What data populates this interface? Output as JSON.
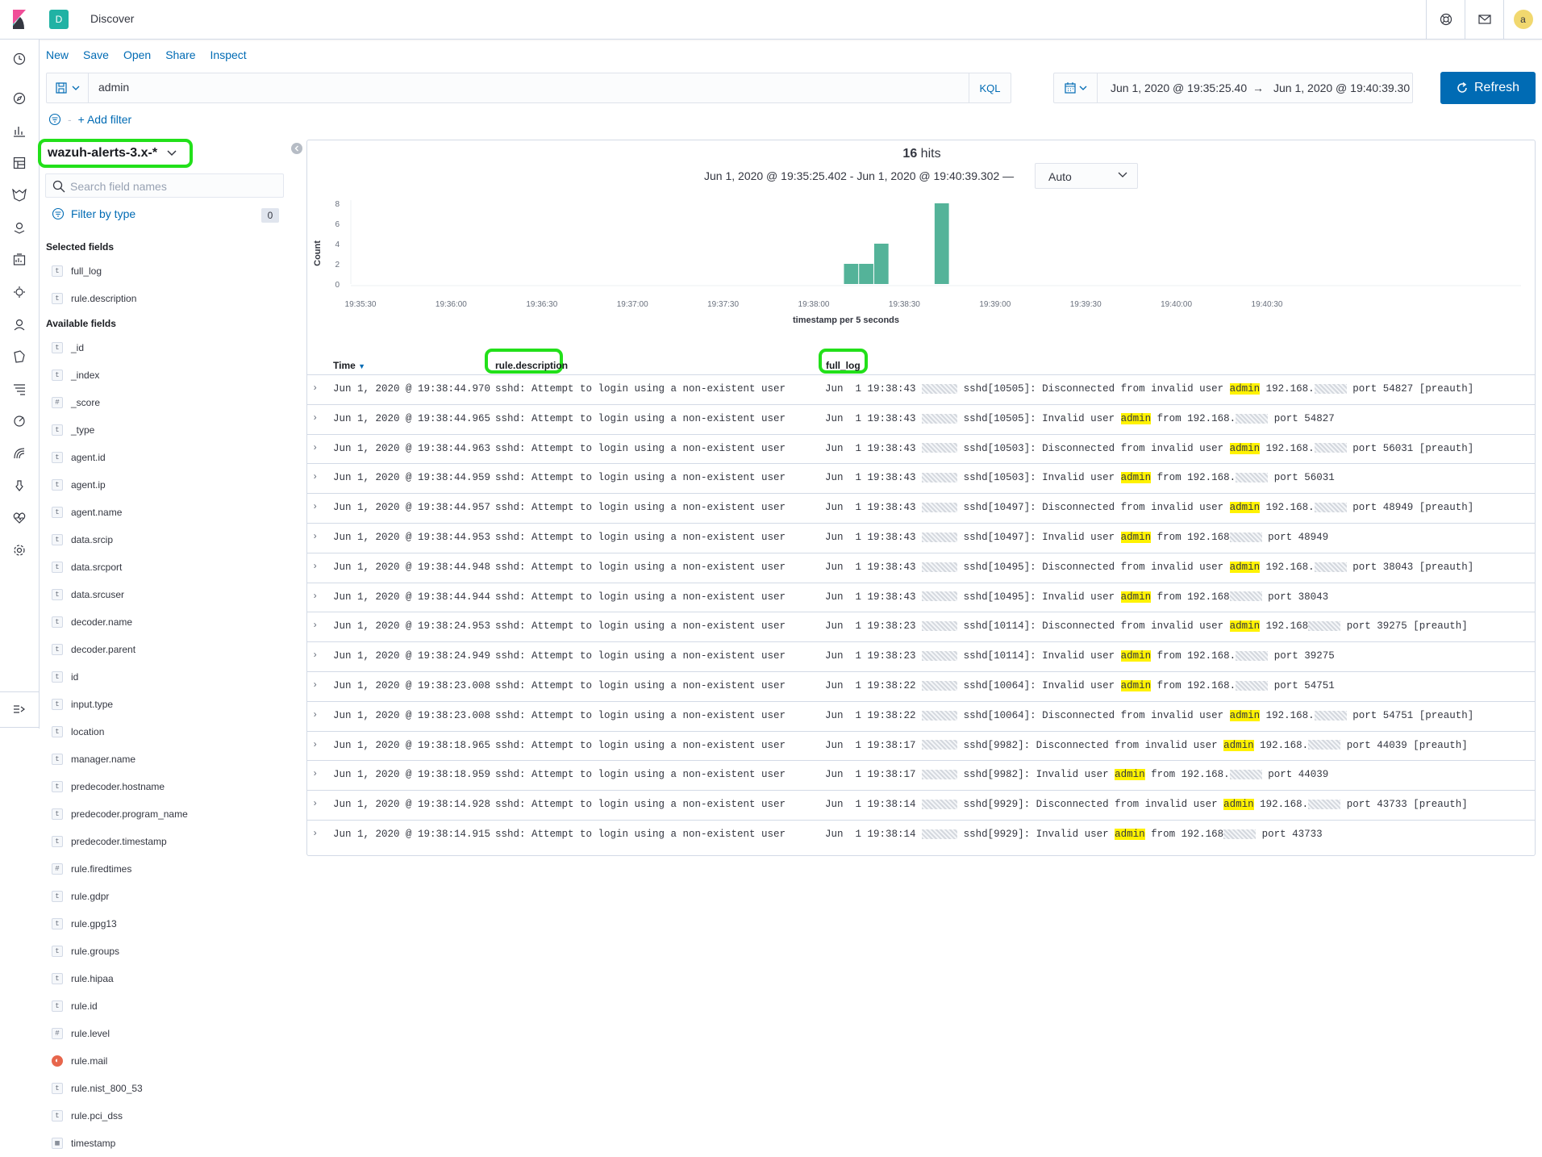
{
  "header": {
    "space_initial": "D",
    "app_title": "Discover",
    "avatar_initial": "a",
    "icons": [
      "help-icon",
      "newsfeed-icon"
    ]
  },
  "nav_icons": [
    "recent-icon",
    "discover-icon",
    "visualize-icon",
    "dashboard-icon",
    "wazuh-icon",
    "maps-icon",
    "canvas-icon",
    "ml-icon",
    "graph-icon",
    "observability-icon",
    "siem-icon",
    "apm-icon",
    "uptime-icon",
    "dev-tools-icon",
    "monitoring-icon",
    "management-icon",
    "dock-navigation-icon"
  ],
  "topnav": [
    "New",
    "Save",
    "Open",
    "Share",
    "Inspect"
  ],
  "query": {
    "value": "admin",
    "language": "KQL"
  },
  "time": {
    "start": "Jun 1, 2020 @ 19:35:25.40",
    "arrow": "→",
    "end": "Jun 1, 2020 @ 19:40:39.30"
  },
  "refresh_label": "Refresh",
  "add_filter_label": "+ Add filter",
  "sidebar": {
    "index_pattern": "wazuh-alerts-3.x-*",
    "search_placeholder": "Search field names",
    "filter_by_type": "Filter by type",
    "filter_count": "0",
    "selected_title": "Selected fields",
    "available_title": "Available fields",
    "selected_fields": [
      {
        "type": "t",
        "name": "full_log"
      },
      {
        "type": "t",
        "name": "rule.description"
      }
    ],
    "available_fields": [
      {
        "type": "t",
        "name": "_id"
      },
      {
        "type": "t",
        "name": "_index"
      },
      {
        "type": "#",
        "name": "_score"
      },
      {
        "type": "t",
        "name": "_type"
      },
      {
        "type": "t",
        "name": "agent.id"
      },
      {
        "type": "t",
        "name": "agent.ip"
      },
      {
        "type": "t",
        "name": "agent.name"
      },
      {
        "type": "t",
        "name": "data.srcip"
      },
      {
        "type": "t",
        "name": "data.srcport"
      },
      {
        "type": "t",
        "name": "data.srcuser"
      },
      {
        "type": "t",
        "name": "decoder.name"
      },
      {
        "type": "t",
        "name": "decoder.parent"
      },
      {
        "type": "t",
        "name": "id"
      },
      {
        "type": "t",
        "name": "input.type"
      },
      {
        "type": "t",
        "name": "location"
      },
      {
        "type": "t",
        "name": "manager.name"
      },
      {
        "type": "t",
        "name": "predecoder.hostname"
      },
      {
        "type": "t",
        "name": "predecoder.program_name"
      },
      {
        "type": "t",
        "name": "predecoder.timestamp"
      },
      {
        "type": "#",
        "name": "rule.firedtimes"
      },
      {
        "type": "t",
        "name": "rule.gdpr"
      },
      {
        "type": "t",
        "name": "rule.gpg13"
      },
      {
        "type": "t",
        "name": "rule.groups"
      },
      {
        "type": "t",
        "name": "rule.hipaa"
      },
      {
        "type": "t",
        "name": "rule.id"
      },
      {
        "type": "#",
        "name": "rule.level"
      },
      {
        "type": "bool",
        "name": "rule.mail"
      },
      {
        "type": "t",
        "name": "rule.nist_800_53"
      },
      {
        "type": "t",
        "name": "rule.pci_dss"
      },
      {
        "type": "date",
        "name": "timestamp"
      }
    ]
  },
  "results": {
    "hits_count": "16",
    "hits_label": "hits",
    "range": "Jun 1, 2020 @ 19:35:25.402 - Jun 1, 2020 @ 19:40:39.302 —",
    "interval": "Auto"
  },
  "chart_data": {
    "type": "bar",
    "ylabel": "Count",
    "xlabel": "timestamp per 5 seconds",
    "ylim": [
      0,
      8
    ],
    "yticks": [
      0,
      2,
      4,
      6,
      8
    ],
    "xticks": [
      "19:35:30",
      "19:36:00",
      "19:36:30",
      "19:37:00",
      "19:37:30",
      "19:38:00",
      "19:38:30",
      "19:39:00",
      "19:39:30",
      "19:40:00",
      "19:40:30"
    ],
    "x": [
      "19:38:10",
      "19:38:15",
      "19:38:20",
      "19:38:40"
    ],
    "values": [
      2,
      2,
      4,
      8
    ],
    "bar_color": "#54b399",
    "grid": false
  },
  "table": {
    "headers": {
      "time": "Time",
      "desc": "rule.description",
      "log": "full_log"
    },
    "rows": [
      {
        "time": "Jun 1, 2020 @ 19:38:44.970",
        "desc": "sshd: Attempt to login using a non-existent user",
        "log_pre": "Jun  1 19:38:43",
        "log_mid": "sshd[10505]: Disconnected from invalid user",
        "kw": "admin",
        "log_post": "192.168.",
        "log_end": "port 54827 [preauth]"
      },
      {
        "time": "Jun 1, 2020 @ 19:38:44.965",
        "desc": "sshd: Attempt to login using a non-existent user",
        "log_pre": "Jun  1 19:38:43",
        "log_mid": "sshd[10505]: Invalid user",
        "kw": "admin",
        "log_post": "from 192.168.",
        "log_end": "port 54827"
      },
      {
        "time": "Jun 1, 2020 @ 19:38:44.963",
        "desc": "sshd: Attempt to login using a non-existent user",
        "log_pre": "Jun  1 19:38:43",
        "log_mid": "sshd[10503]: Disconnected from invalid user",
        "kw": "admin",
        "log_post": "192.168.",
        "log_end": "port 56031 [preauth]"
      },
      {
        "time": "Jun 1, 2020 @ 19:38:44.959",
        "desc": "sshd: Attempt to login using a non-existent user",
        "log_pre": "Jun  1 19:38:43",
        "log_mid": "sshd[10503]: Invalid user",
        "kw": "admin",
        "log_post": "from 192.168.",
        "log_end": "port 56031"
      },
      {
        "time": "Jun 1, 2020 @ 19:38:44.957",
        "desc": "sshd: Attempt to login using a non-existent user",
        "log_pre": "Jun  1 19:38:43",
        "log_mid": "sshd[10497]: Disconnected from invalid user",
        "kw": "admin",
        "log_post": "192.168.",
        "log_end": "port 48949 [preauth]"
      },
      {
        "time": "Jun 1, 2020 @ 19:38:44.953",
        "desc": "sshd: Attempt to login using a non-existent user",
        "log_pre": "Jun  1 19:38:43",
        "log_mid": "sshd[10497]: Invalid user",
        "kw": "admin",
        "log_post": "from 192.168",
        "log_end": "port 48949"
      },
      {
        "time": "Jun 1, 2020 @ 19:38:44.948",
        "desc": "sshd: Attempt to login using a non-existent user",
        "log_pre": "Jun  1 19:38:43",
        "log_mid": "sshd[10495]: Disconnected from invalid user",
        "kw": "admin",
        "log_post": "192.168.",
        "log_end": "port 38043 [preauth]"
      },
      {
        "time": "Jun 1, 2020 @ 19:38:44.944",
        "desc": "sshd: Attempt to login using a non-existent user",
        "log_pre": "Jun  1 19:38:43",
        "log_mid": "sshd[10495]: Invalid user",
        "kw": "admin",
        "log_post": "from 192.168",
        "log_end": "port 38043"
      },
      {
        "time": "Jun 1, 2020 @ 19:38:24.953",
        "desc": "sshd: Attempt to login using a non-existent user",
        "log_pre": "Jun  1 19:38:23",
        "log_mid": "sshd[10114]: Disconnected from invalid user",
        "kw": "admin",
        "log_post": "192.168",
        "log_end": "port 39275 [preauth]"
      },
      {
        "time": "Jun 1, 2020 @ 19:38:24.949",
        "desc": "sshd: Attempt to login using a non-existent user",
        "log_pre": "Jun  1 19:38:23",
        "log_mid": "sshd[10114]: Invalid user",
        "kw": "admin",
        "log_post": "from 192.168.",
        "log_end": "port 39275"
      },
      {
        "time": "Jun 1, 2020 @ 19:38:23.008",
        "desc": "sshd: Attempt to login using a non-existent user",
        "log_pre": "Jun  1 19:38:22",
        "log_mid": "sshd[10064]: Invalid user",
        "kw": "admin",
        "log_post": "from 192.168.",
        "log_end": "port 54751"
      },
      {
        "time": "Jun 1, 2020 @ 19:38:23.008",
        "desc": "sshd: Attempt to login using a non-existent user",
        "log_pre": "Jun  1 19:38:22",
        "log_mid": "sshd[10064]: Disconnected from invalid user",
        "kw": "admin",
        "log_post": "192.168.",
        "log_end": "port 54751 [preauth]"
      },
      {
        "time": "Jun 1, 2020 @ 19:38:18.965",
        "desc": "sshd: Attempt to login using a non-existent user",
        "log_pre": "Jun  1 19:38:17",
        "log_mid": "sshd[9982]: Disconnected from invalid user",
        "kw": "admin",
        "log_post": "192.168.",
        "log_end": "port 44039 [preauth]"
      },
      {
        "time": "Jun 1, 2020 @ 19:38:18.959",
        "desc": "sshd: Attempt to login using a non-existent user",
        "log_pre": "Jun  1 19:38:17",
        "log_mid": "sshd[9982]: Invalid user",
        "kw": "admin",
        "log_post": "from 192.168.",
        "log_end": "port 44039"
      },
      {
        "time": "Jun 1, 2020 @ 19:38:14.928",
        "desc": "sshd: Attempt to login using a non-existent user",
        "log_pre": "Jun  1 19:38:14",
        "log_mid": "sshd[9929]: Disconnected from invalid user",
        "kw": "admin",
        "log_post": "192.168.",
        "log_end": "port 43733 [preauth]"
      },
      {
        "time": "Jun 1, 2020 @ 19:38:14.915",
        "desc": "sshd: Attempt to login using a non-existent user",
        "log_pre": "Jun  1 19:38:14",
        "log_mid": "sshd[9929]: Invalid user",
        "kw": "admin",
        "log_post": "from 192.168",
        "log_end": "port 43733"
      }
    ]
  }
}
